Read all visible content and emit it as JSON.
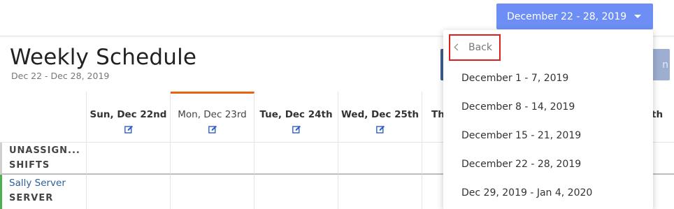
{
  "header": {
    "week_selector_label": "December 22 - 28, 2019"
  },
  "page": {
    "title": "Weekly Schedule",
    "subtitle": "Dec 22 - Dec 28, 2019",
    "partial_button_text": "n"
  },
  "grid": {
    "days": [
      {
        "label": "Sun, Dec 22nd"
      },
      {
        "label": "Mon, Dec 23rd",
        "active": true
      },
      {
        "label": "Tue, Dec 24th"
      },
      {
        "label": "Wed, Dec 25th"
      },
      {
        "label": "Th"
      },
      {
        "label": "th"
      }
    ],
    "unassigned_label_line1": "UNASSIGN...",
    "unassigned_label_line2": "SHIFTS",
    "employees": [
      {
        "name": "Sally Server",
        "role": "SERVER"
      }
    ]
  },
  "dropdown": {
    "back_label": "Back",
    "options": [
      "December 1 - 7, 2019",
      "December 8 - 14, 2019",
      "December 15 - 21, 2019",
      "December 22 - 28, 2019",
      "Dec 29, 2019 - Jan 4, 2020"
    ]
  },
  "colors": {
    "accent": "#6d8ff5",
    "active_day": "#e8650e",
    "highlight": "#e01e1e",
    "employee_bar": "#4caf50"
  }
}
